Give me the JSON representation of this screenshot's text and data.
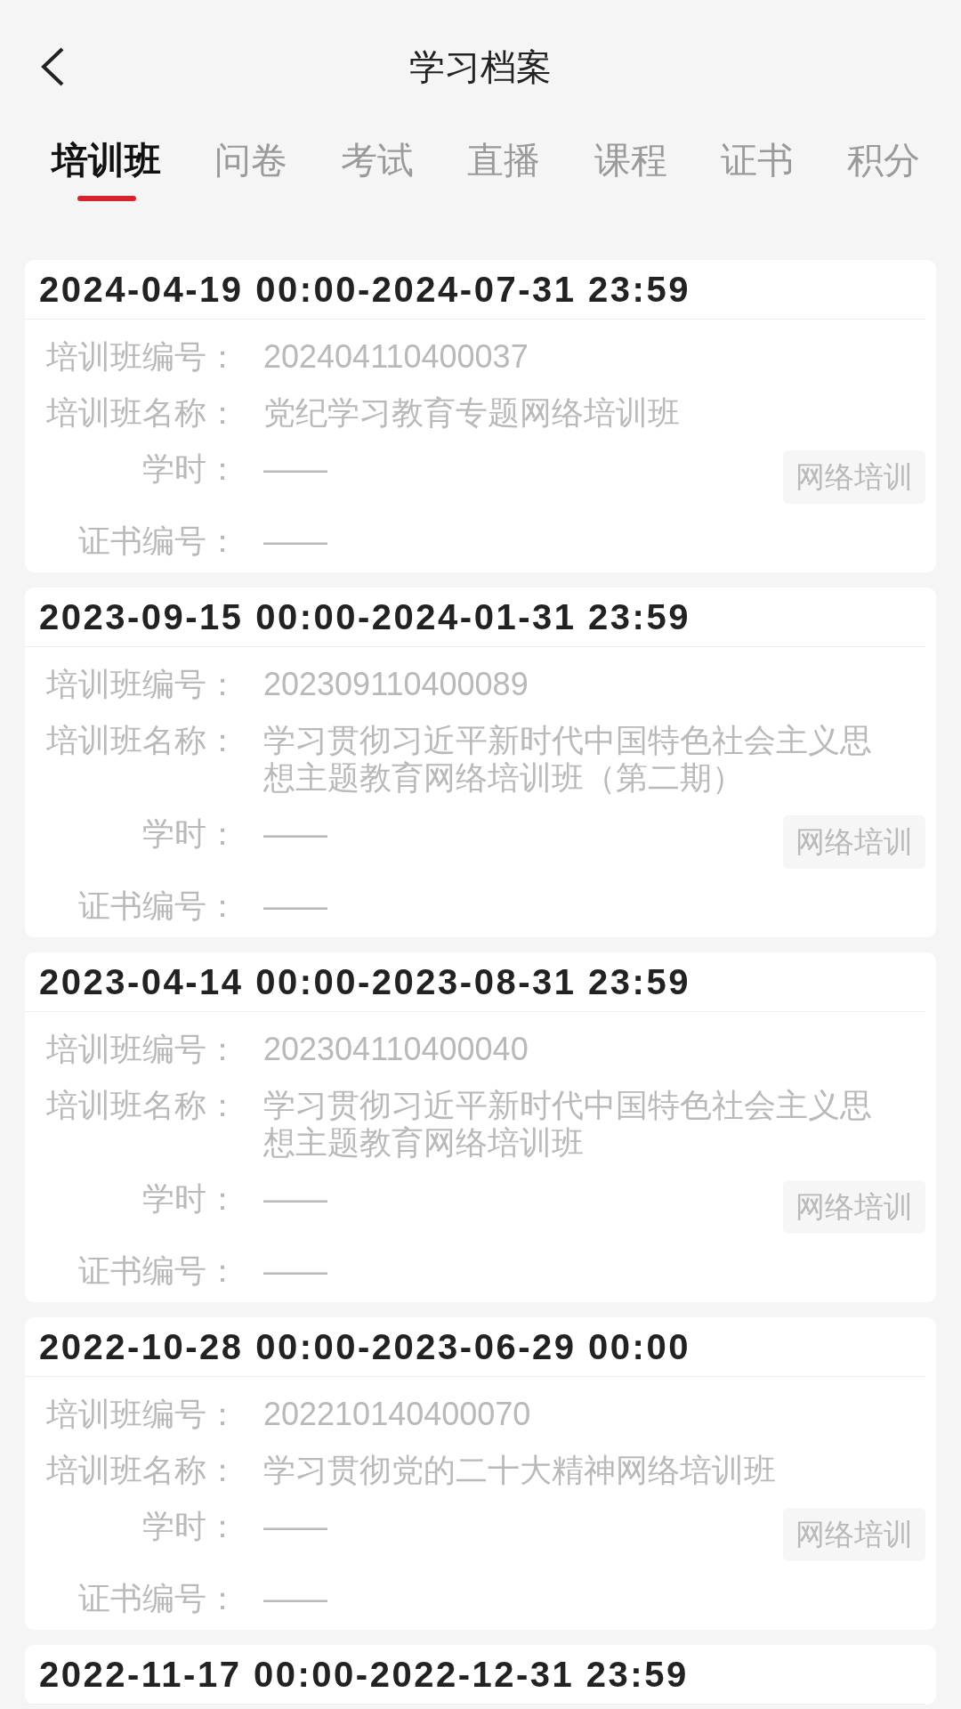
{
  "header": {
    "title": "学习档案"
  },
  "tabs": [
    {
      "label": "培训班",
      "selected": true
    },
    {
      "label": "问卷",
      "selected": false
    },
    {
      "label": "考试",
      "selected": false
    },
    {
      "label": "直播",
      "selected": false
    },
    {
      "label": "课程",
      "selected": false
    },
    {
      "label": "证书",
      "selected": false
    },
    {
      "label": "积分",
      "selected": false
    }
  ],
  "records": [
    {
      "period": "2024-04-19 00:00-2024-07-31 23:59",
      "rows": [
        {
          "label": "培训班编号：",
          "value": "202404110400037"
        },
        {
          "label": "培训班名称：",
          "value": "党纪学习教育专题网络培训班"
        },
        {
          "label": "学时：",
          "value": "——",
          "tag": "网络培训"
        },
        {
          "label": "证书编号：",
          "value": "——"
        }
      ]
    },
    {
      "period": "2023-09-15 00:00-2024-01-31 23:59",
      "rows": [
        {
          "label": "培训班编号：",
          "value": "202309110400089"
        },
        {
          "label": "培训班名称：",
          "value": "学习贯彻习近平新时代中国特色社会主义思想主题教育网络培训班（第二期）"
        },
        {
          "label": "学时：",
          "value": "——",
          "tag": "网络培训"
        },
        {
          "label": "证书编号：",
          "value": "——"
        }
      ]
    },
    {
      "period": "2023-04-14 00:00-2023-08-31 23:59",
      "rows": [
        {
          "label": "培训班编号：",
          "value": "202304110400040"
        },
        {
          "label": "培训班名称：",
          "value": "学习贯彻习近平新时代中国特色社会主义思想主题教育网络培训班"
        },
        {
          "label": "学时：",
          "value": "——",
          "tag": "网络培训"
        },
        {
          "label": "证书编号：",
          "value": "——"
        }
      ]
    },
    {
      "period": "2022-10-28 00:00-2023-06-29 00:00",
      "rows": [
        {
          "label": "培训班编号：",
          "value": "202210140400070"
        },
        {
          "label": "培训班名称：",
          "value": "学习贯彻党的二十大精神网络培训班"
        },
        {
          "label": "学时：",
          "value": "——",
          "tag": "网络培训"
        },
        {
          "label": "证书编号：",
          "value": "——"
        }
      ]
    },
    {
      "period": "2022-11-17 00:00-2022-12-31 23:59"
    }
  ]
}
